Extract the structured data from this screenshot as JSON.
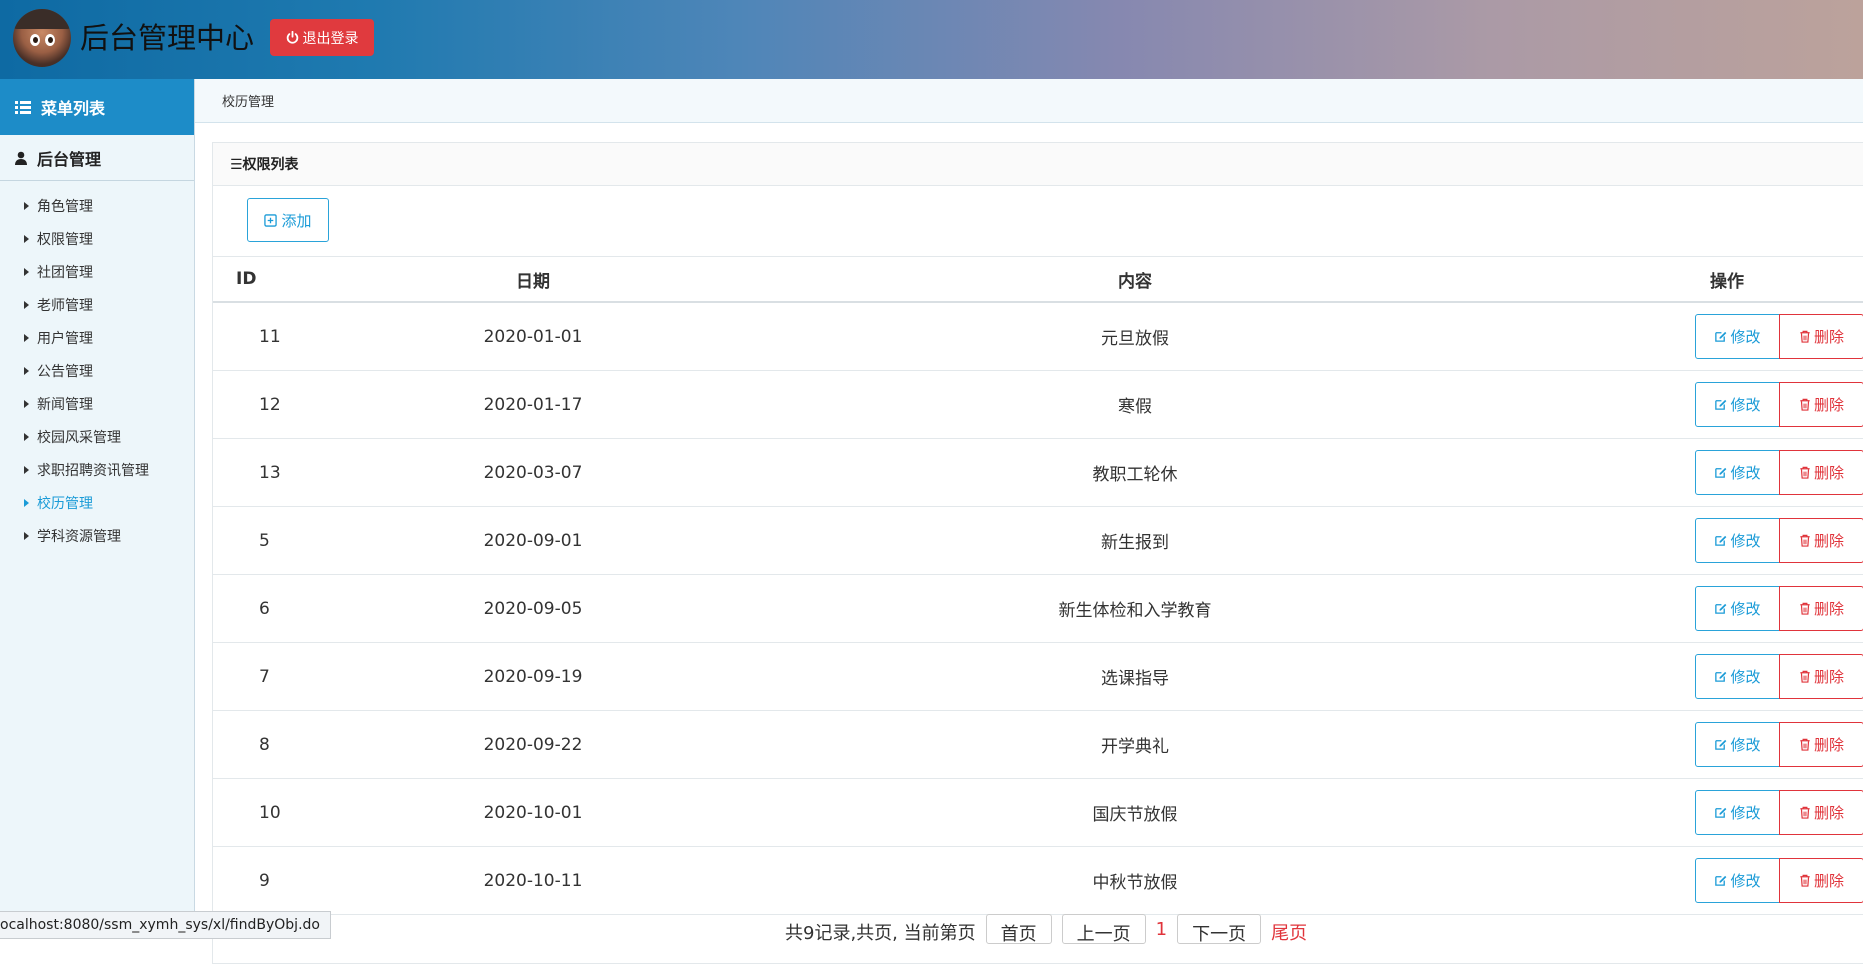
{
  "header": {
    "title": "后台管理中心",
    "logout_label": "退出登录"
  },
  "sidebar": {
    "menu_title": "菜单列表",
    "group_title": "后台管理",
    "items": [
      {
        "label": "角色管理"
      },
      {
        "label": "权限管理"
      },
      {
        "label": "社团管理"
      },
      {
        "label": "老师管理"
      },
      {
        "label": "用户管理"
      },
      {
        "label": "公告管理"
      },
      {
        "label": "新闻管理"
      },
      {
        "label": "校园风采管理"
      },
      {
        "label": "求职招聘资讯管理"
      },
      {
        "label": "校历管理"
      },
      {
        "label": "学科资源管理"
      }
    ],
    "active_item": "校历管理"
  },
  "breadcrumb": "校历管理",
  "panel": {
    "title": "☰权限列表",
    "add_label": "添加"
  },
  "table": {
    "headers": [
      "ID",
      "日期",
      "内容",
      "操作"
    ],
    "edit_label": "修改",
    "delete_label": "删除",
    "rows": [
      {
        "id": "11",
        "date": "2020-01-01",
        "content": "元旦放假"
      },
      {
        "id": "12",
        "date": "2020-01-17",
        "content": "寒假"
      },
      {
        "id": "13",
        "date": "2020-03-07",
        "content": "教职工轮休"
      },
      {
        "id": "5",
        "date": "2020-09-01",
        "content": "新生报到"
      },
      {
        "id": "6",
        "date": "2020-09-05",
        "content": "新生体检和入学教育"
      },
      {
        "id": "7",
        "date": "2020-09-19",
        "content": "选课指导"
      },
      {
        "id": "8",
        "date": "2020-09-22",
        "content": "开学典礼"
      },
      {
        "id": "10",
        "date": "2020-10-01",
        "content": "国庆节放假"
      },
      {
        "id": "9",
        "date": "2020-10-11",
        "content": "中秋节放假"
      }
    ]
  },
  "pager": {
    "summary": "共9记录,共页, 当前第页",
    "first": "首页",
    "prev": "上一页",
    "current": "1",
    "next": "下一页",
    "last": "尾页"
  },
  "statusbar": "ocalhost:8080/ssm_xymh_sys/xl/findByObj.do",
  "colors": {
    "accent": "#1a9bd7",
    "danger": "#e0343b",
    "sidebar_bg": "#edf6fa"
  }
}
